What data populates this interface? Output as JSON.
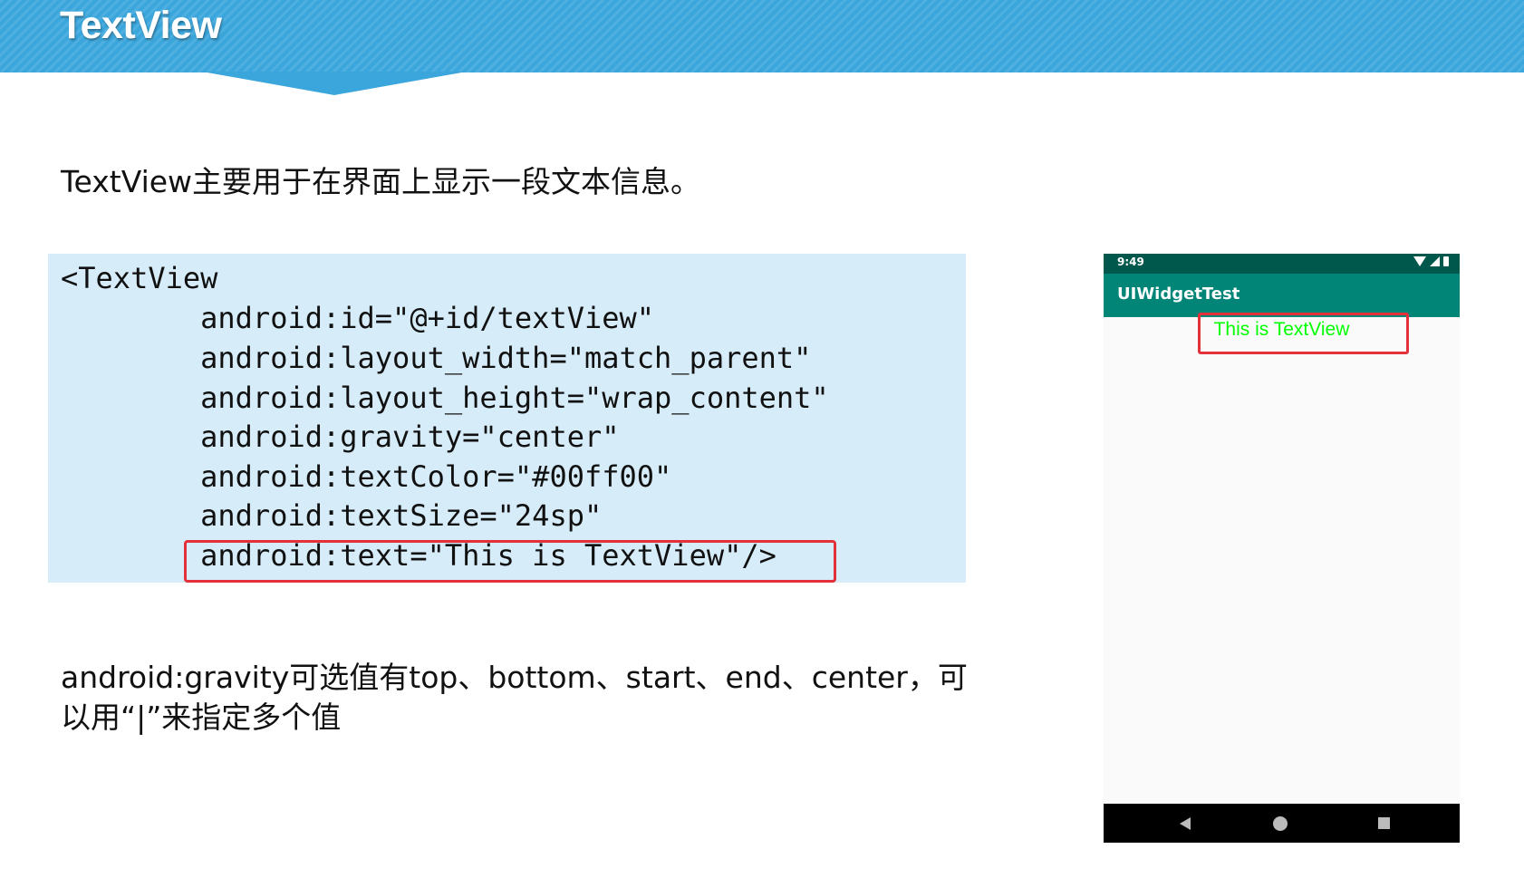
{
  "slide": {
    "title": "TextView",
    "intro": "TextView主要用于在界面上显示一段文本信息。",
    "code_lines": [
      "<TextView",
      "        android:id=\"@+id/textView\"",
      "        android:layout_width=\"match_parent\"",
      "        android:layout_height=\"wrap_content\"",
      "        android:gravity=\"center\"",
      "        android:textColor=\"#00ff00\"",
      "        android:textSize=\"24sp\"",
      "        android:text=\"This is TextView\"/>"
    ],
    "gravity_note_line1": "android:gravity可选值有top、bottom、start、end、center，可",
    "gravity_note_line2": "以用“|”来指定多个值"
  },
  "phone": {
    "status_time": "9:49",
    "app_title": "UIWidgetTest",
    "textview_text": "This is TextView",
    "textview_color": "#00ff00",
    "status_bar_color": "#00574b",
    "app_bar_color": "#008577",
    "nav_icons": [
      "back-icon",
      "home-icon",
      "recents-icon"
    ]
  },
  "colors": {
    "header": "#3aa6dc",
    "code_background": "#d6ecf8",
    "highlight_border": "#e3313c"
  }
}
